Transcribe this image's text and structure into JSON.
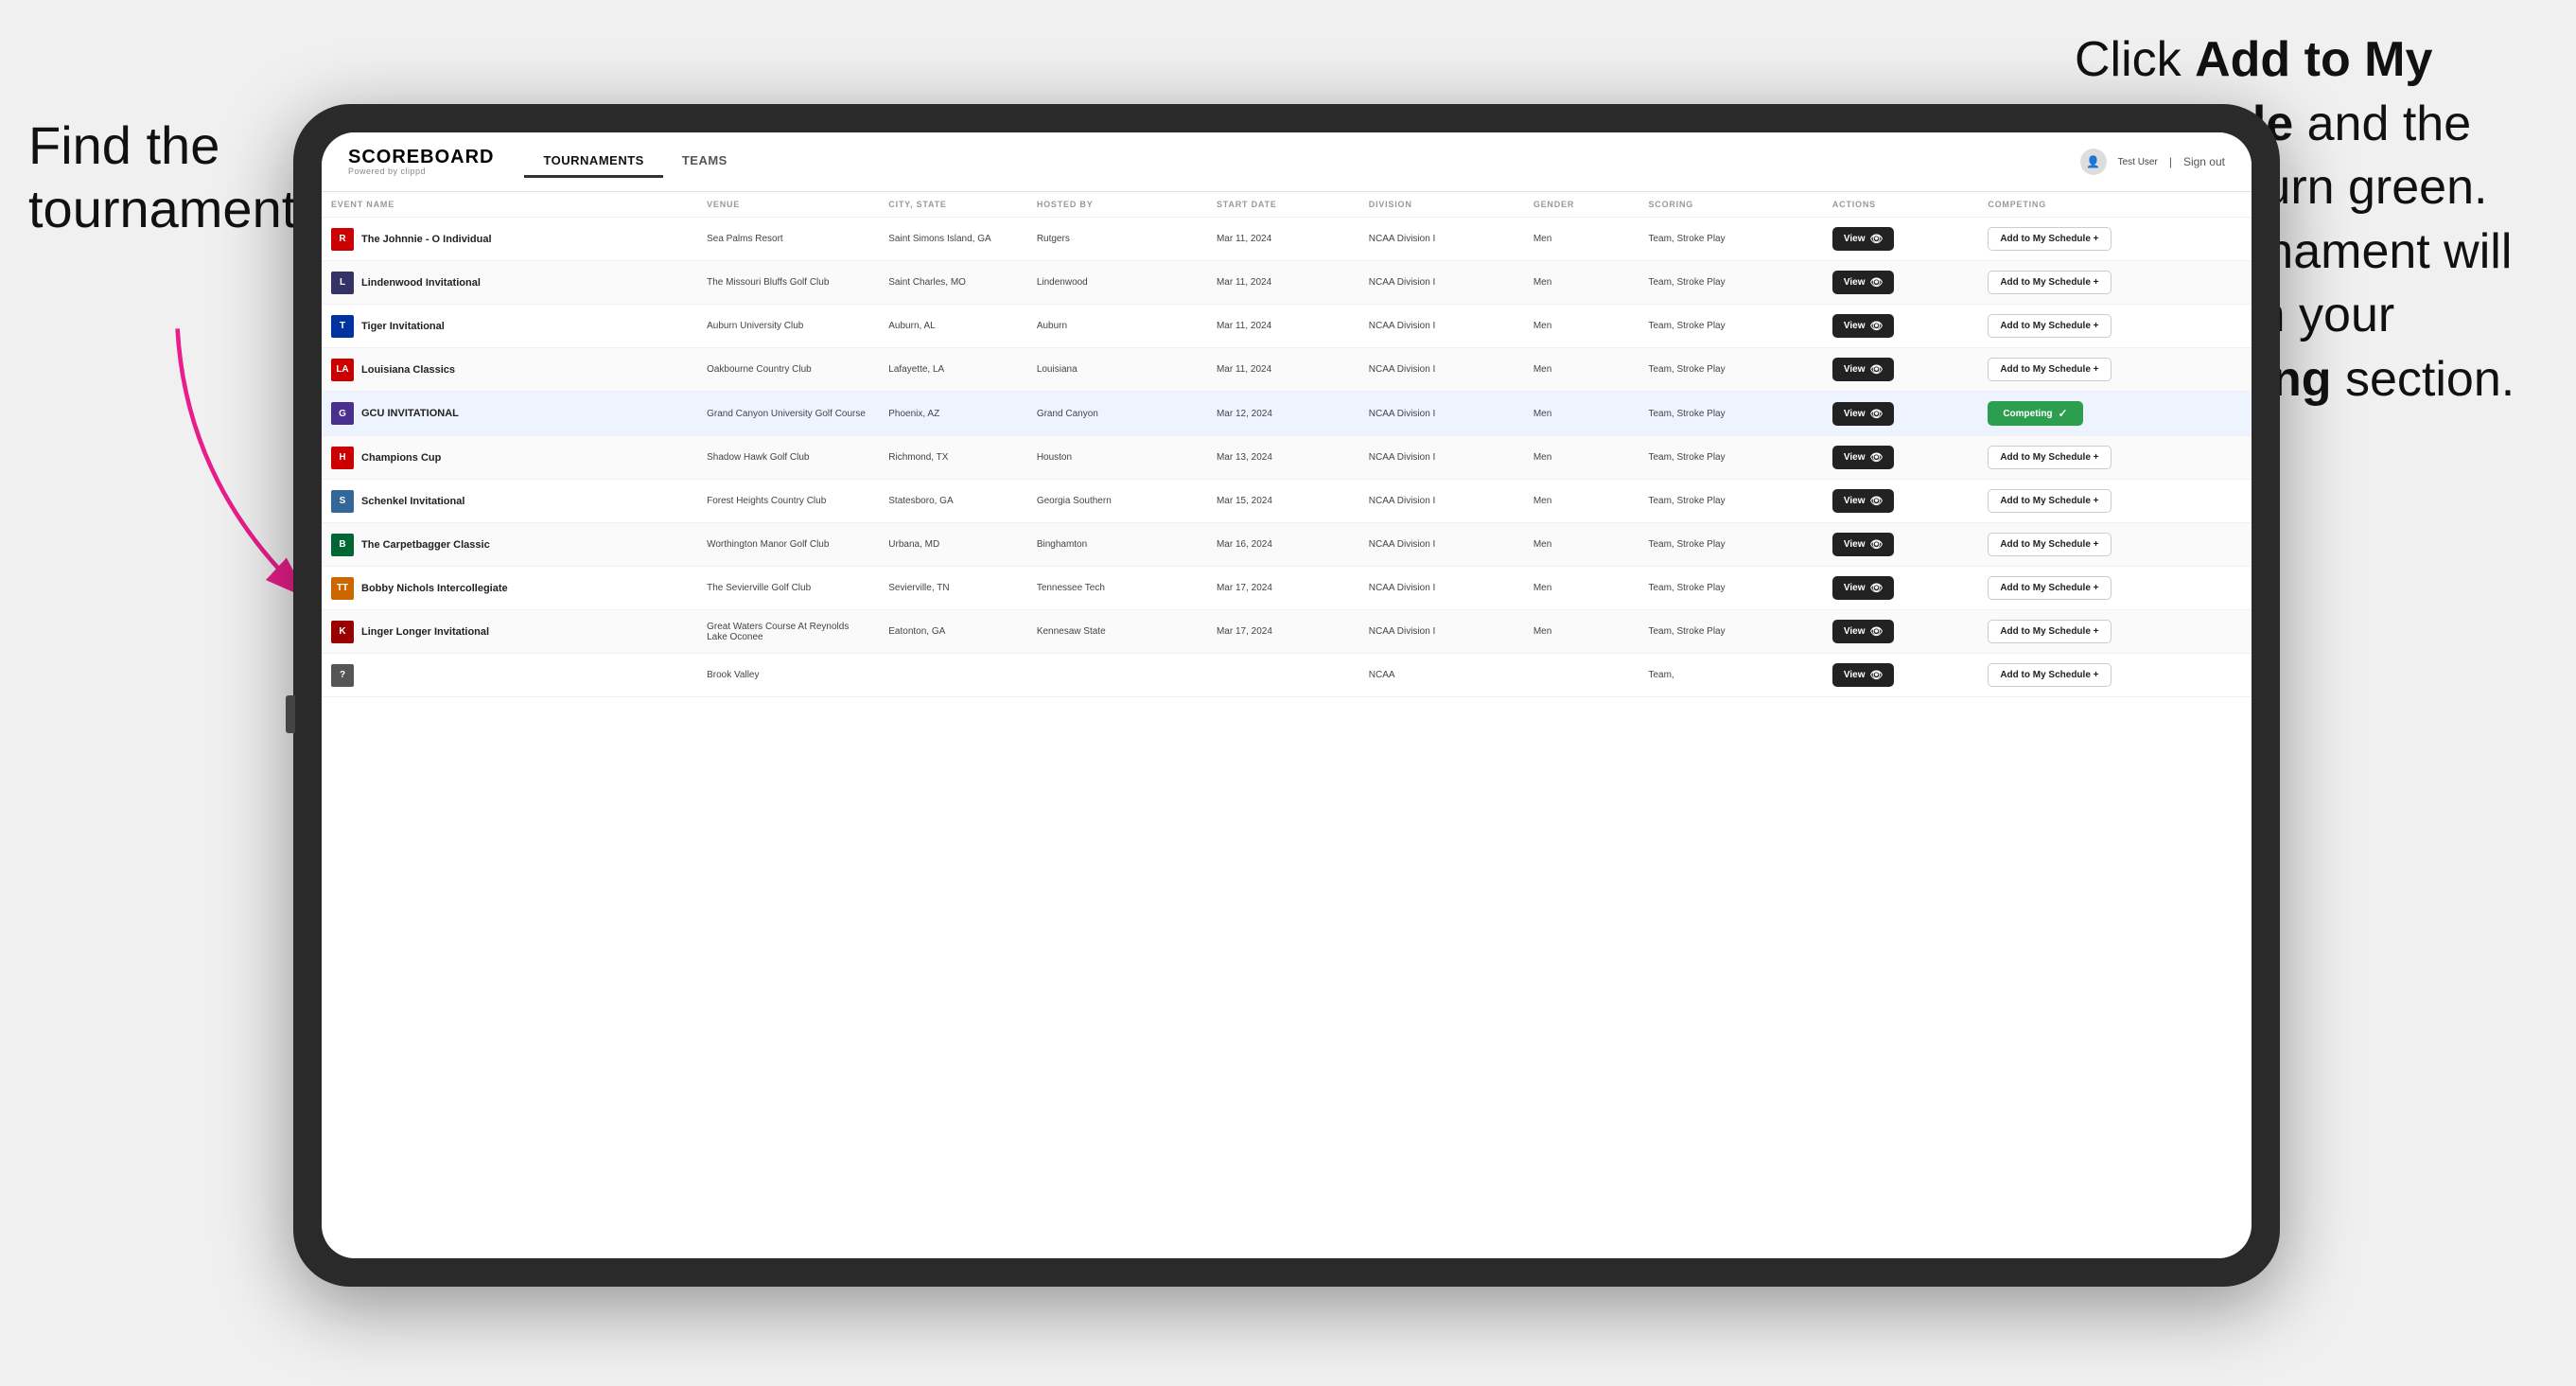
{
  "annotations": {
    "left": "Find the\ntournament.",
    "right_part1": "Click ",
    "right_bold1": "Add to My\nSchedule",
    "right_part2": " and the box will turn green. This tournament will now be in your ",
    "right_bold2": "Competing",
    "right_part3": " section."
  },
  "app": {
    "logo": "SCOREBOARD",
    "logo_sub": "Powered by clippd",
    "nav_tabs": [
      "TOURNAMENTS",
      "TEAMS"
    ],
    "active_tab": "TOURNAMENTS",
    "user": "Test User",
    "sign_out": "Sign out"
  },
  "table": {
    "columns": [
      "EVENT NAME",
      "VENUE",
      "CITY, STATE",
      "HOSTED BY",
      "START DATE",
      "DIVISION",
      "GENDER",
      "SCORING",
      "ACTIONS",
      "COMPETING"
    ],
    "rows": [
      {
        "logo_color": "#cc0000",
        "logo_letter": "R",
        "event_name": "The Johnnie - O Individual",
        "venue": "Sea Palms Resort",
        "city_state": "Saint Simons Island, GA",
        "hosted_by": "Rutgers",
        "start_date": "Mar 11, 2024",
        "division": "NCAA Division I",
        "gender": "Men",
        "scoring": "Team, Stroke Play",
        "action": "View",
        "competing_status": "add",
        "competing_label": "Add to My Schedule +"
      },
      {
        "logo_color": "#333366",
        "logo_letter": "L",
        "event_name": "Lindenwood Invitational",
        "venue": "The Missouri Bluffs Golf Club",
        "city_state": "Saint Charles, MO",
        "hosted_by": "Lindenwood",
        "start_date": "Mar 11, 2024",
        "division": "NCAA Division I",
        "gender": "Men",
        "scoring": "Team, Stroke Play",
        "action": "View",
        "competing_status": "add",
        "competing_label": "Add to My Schedule +"
      },
      {
        "logo_color": "#0033a0",
        "logo_letter": "T",
        "event_name": "Tiger Invitational",
        "venue": "Auburn University Club",
        "city_state": "Auburn, AL",
        "hosted_by": "Auburn",
        "start_date": "Mar 11, 2024",
        "division": "NCAA Division I",
        "gender": "Men",
        "scoring": "Team, Stroke Play",
        "action": "View",
        "competing_status": "add",
        "competing_label": "Add to My Schedule +"
      },
      {
        "logo_color": "#cc0000",
        "logo_letter": "LA",
        "event_name": "Louisiana Classics",
        "venue": "Oakbourne Country Club",
        "city_state": "Lafayette, LA",
        "hosted_by": "Louisiana",
        "start_date": "Mar 11, 2024",
        "division": "NCAA Division I",
        "gender": "Men",
        "scoring": "Team, Stroke Play",
        "action": "View",
        "competing_status": "add",
        "competing_label": "Add to My Schedule +"
      },
      {
        "logo_color": "#4a2f8f",
        "logo_letter": "G",
        "event_name": "GCU INVITATIONAL",
        "venue": "Grand Canyon University Golf Course",
        "city_state": "Phoenix, AZ",
        "hosted_by": "Grand Canyon",
        "start_date": "Mar 12, 2024",
        "division": "NCAA Division I",
        "gender": "Men",
        "scoring": "Team, Stroke Play",
        "action": "View",
        "competing_status": "competing",
        "competing_label": "Competing",
        "highlighted": true
      },
      {
        "logo_color": "#cc0000",
        "logo_letter": "H",
        "event_name": "Champions Cup",
        "venue": "Shadow Hawk Golf Club",
        "city_state": "Richmond, TX",
        "hosted_by": "Houston",
        "start_date": "Mar 13, 2024",
        "division": "NCAA Division I",
        "gender": "Men",
        "scoring": "Team, Stroke Play",
        "action": "View",
        "competing_status": "add",
        "competing_label": "Add to My Schedule +"
      },
      {
        "logo_color": "#336699",
        "logo_letter": "S",
        "event_name": "Schenkel Invitational",
        "venue": "Forest Heights Country Club",
        "city_state": "Statesboro, GA",
        "hosted_by": "Georgia Southern",
        "start_date": "Mar 15, 2024",
        "division": "NCAA Division I",
        "gender": "Men",
        "scoring": "Team, Stroke Play",
        "action": "View",
        "competing_status": "add",
        "competing_label": "Add to My Schedule +"
      },
      {
        "logo_color": "#006633",
        "logo_letter": "B",
        "event_name": "The Carpetbagger Classic",
        "venue": "Worthington Manor Golf Club",
        "city_state": "Urbana, MD",
        "hosted_by": "Binghamton",
        "start_date": "Mar 16, 2024",
        "division": "NCAA Division I",
        "gender": "Men",
        "scoring": "Team, Stroke Play",
        "action": "View",
        "competing_status": "add",
        "competing_label": "Add to My Schedule +"
      },
      {
        "logo_color": "#cc6600",
        "logo_letter": "TT",
        "event_name": "Bobby Nichols Intercollegiate",
        "venue": "The Sevierville Golf Club",
        "city_state": "Sevierville, TN",
        "hosted_by": "Tennessee Tech",
        "start_date": "Mar 17, 2024",
        "division": "NCAA Division I",
        "gender": "Men",
        "scoring": "Team, Stroke Play",
        "action": "View",
        "competing_status": "add",
        "competing_label": "Add to My Schedule +"
      },
      {
        "logo_color": "#990000",
        "logo_letter": "K",
        "event_name": "Linger Longer Invitational",
        "venue": "Great Waters Course At Reynolds Lake Oconee",
        "city_state": "Eatonton, GA",
        "hosted_by": "Kennesaw State",
        "start_date": "Mar 17, 2024",
        "division": "NCAA Division I",
        "gender": "Men",
        "scoring": "Team, Stroke Play",
        "action": "View",
        "competing_status": "add",
        "competing_label": "Add to My Schedule +"
      },
      {
        "logo_color": "#555555",
        "logo_letter": "?",
        "event_name": "",
        "venue": "Brook Valley",
        "city_state": "",
        "hosted_by": "",
        "start_date": "",
        "division": "NCAA",
        "gender": "",
        "scoring": "Team,",
        "action": "View",
        "competing_status": "add",
        "competing_label": "Add to My Schedule +"
      }
    ]
  },
  "colors": {
    "competing_green": "#2d9e4f",
    "arrow_pink": "#e91e8c"
  }
}
